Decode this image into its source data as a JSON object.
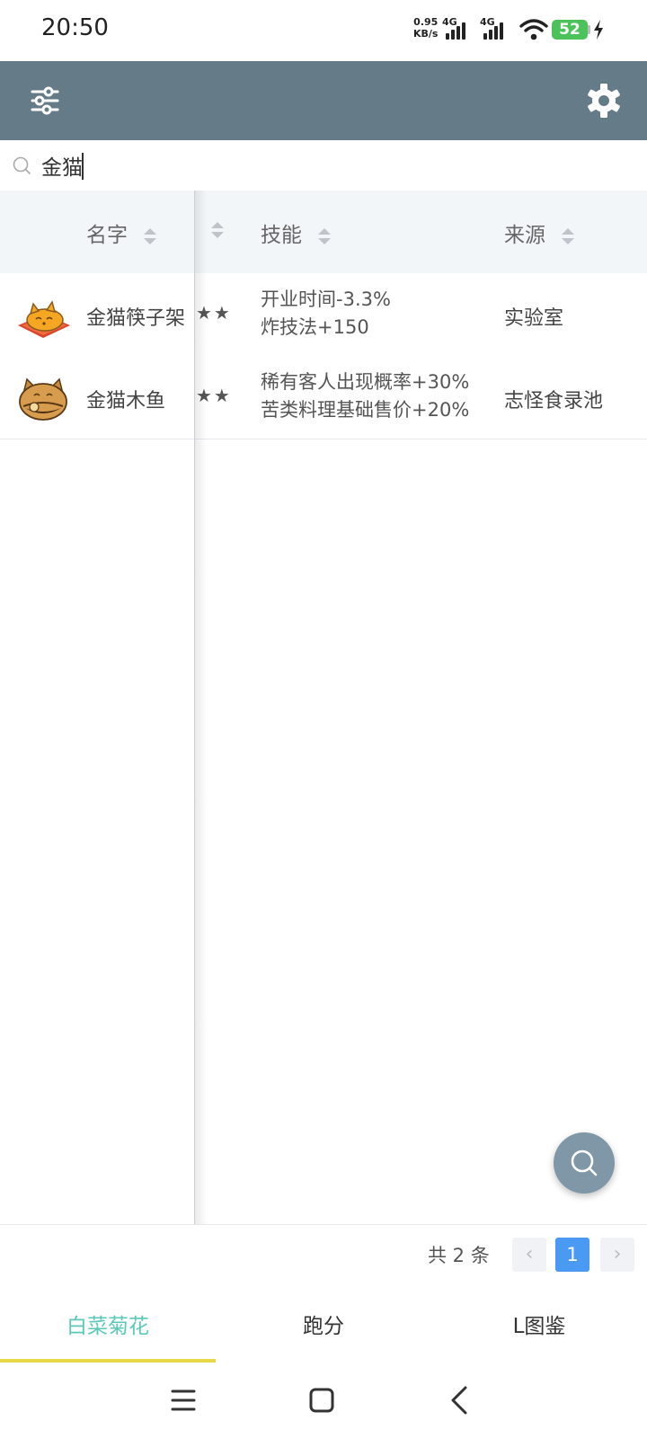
{
  "status_bar": {
    "time": "20:50",
    "net_speed_value": "0.95",
    "net_speed_unit": "KB/s",
    "sim1": "4G",
    "sim2": "4G",
    "battery": "52"
  },
  "app_bar": {
    "filter_icon": "sliders-icon",
    "settings_icon": "gear-icon"
  },
  "search": {
    "value": "金猫",
    "placeholder": ""
  },
  "table": {
    "columns": [
      "名字",
      "",
      "技能",
      "来源"
    ],
    "rows": [
      {
        "name": "金猫筷子架",
        "stars": "★★",
        "skill_lines": [
          "开业时间-3.3%",
          "炸技法+150"
        ],
        "source": "实验室",
        "icon": "golden-cat-chopstick-rest-icon"
      },
      {
        "name": "金猫木鱼",
        "stars": "★★",
        "skill_lines": [
          "稀有客人出现概率+30%",
          "苦类料理基础售价+20%"
        ],
        "source": "志怪食录池",
        "icon": "golden-cat-wooden-fish-icon"
      }
    ]
  },
  "pagination": {
    "total": "共 2 条",
    "current_page": "1",
    "prev": "‹",
    "next": "›"
  },
  "tabs": [
    {
      "label": "白菜菊花",
      "active": true
    },
    {
      "label": "跑分",
      "active": false
    },
    {
      "label": "L图鉴",
      "active": false
    }
  ],
  "colors": {
    "app_bar": "#667b88",
    "active_tab": "#5cc9b8",
    "tab_indicator": "#e9d94a",
    "page_active": "#4a9af4"
  }
}
